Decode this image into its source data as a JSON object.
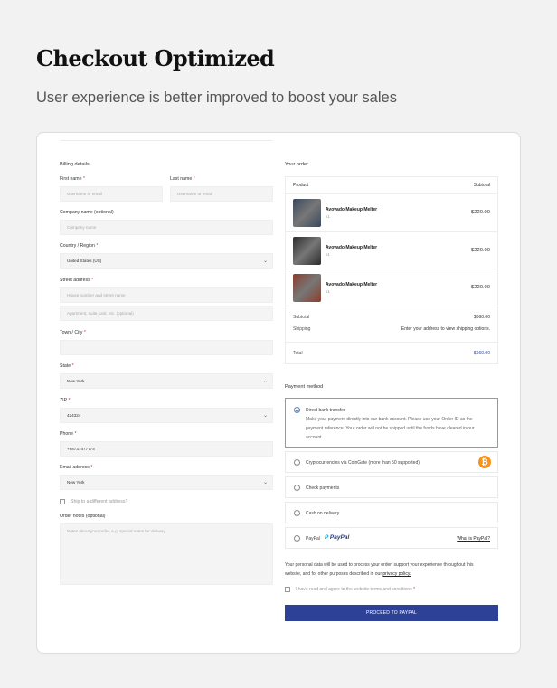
{
  "hero": {
    "title": "Checkout Optimized",
    "subtitle": "User experience is better improved to boost your sales"
  },
  "billing": {
    "heading": "Billing details",
    "first_name_label": "First name",
    "first_name_placeholder": "Username or email",
    "last_name_label": "Last name",
    "last_name_placeholder": "Username or email",
    "company_label": "Company name (optional)",
    "company_placeholder": "Company name",
    "country_label": "Country / Region",
    "country_value": "United States (US)",
    "street_label": "Street address",
    "street_placeholder": "House number and street name",
    "street2_placeholder": "Apartment, suite, unit, etc. (optional)",
    "town_label": "Town / City",
    "town_value": "",
    "state_label": "State",
    "state_value": "New York",
    "zip_label": "ZIP",
    "zip_value": "424324",
    "phone_label": "Phone",
    "phone_value": "+98737477774",
    "email_label": "Email address",
    "email_value": "New York",
    "ship_different_label": "Ship to a different address?",
    "notes_label": "Order notes (optional)",
    "notes_placeholder": "Notes about your order, e.g. special notes for delivery."
  },
  "order": {
    "heading": "Your order",
    "col_product": "Product",
    "col_subtotal": "Subtotal",
    "items": [
      {
        "name": "Avovado Makeup Melter",
        "qty": "x1",
        "price": "$220.00",
        "color": "#3b4a5e"
      },
      {
        "name": "Avovado Makeup Melter",
        "qty": "x1",
        "price": "$220.00",
        "color": "#2c2c2c"
      },
      {
        "name": "Avovado Makeup Melter",
        "qty": "x1",
        "price": "$220.00",
        "color": "#8a3e2c"
      }
    ],
    "subtotal_label": "Subtotal",
    "subtotal_value": "$660.00",
    "shipping_label": "Shipping",
    "shipping_value": "Enter your address to view shipping options.",
    "total_label": "Total",
    "total_value": "$660.00"
  },
  "payment": {
    "heading": "Payment method",
    "bank_label": "Direct bank transfer",
    "bank_desc_1": "Make your payment directly into our bank account. Please use your Order ID as the",
    "bank_desc_2": "payment reference. Your order will not be shipped until the funds have cleared in our",
    "bank_desc_3": "account.",
    "crypto_label": "Cryptocurrencies via CoinGate (more than 50 supported)",
    "check_label": "Check payments",
    "cod_label": "Cash on delivery",
    "paypal_label": "PayPal",
    "paypal_logo": "PayPal",
    "paypal_link": "What is PayPal?"
  },
  "privacy": {
    "line1": "Your personal data will be used to process your order, support your experience throughout this",
    "line2_pre": "website, and for other purposes described in our ",
    "line2_link": "privacy policy.",
    "terms": "I have read and agree to the website terms and conditions"
  },
  "proceed_label": "PROCEED TO PAYPAL",
  "colors": {
    "accent": "#2d4296",
    "required": "#c0392b",
    "bitcoin": "#f7931a"
  }
}
